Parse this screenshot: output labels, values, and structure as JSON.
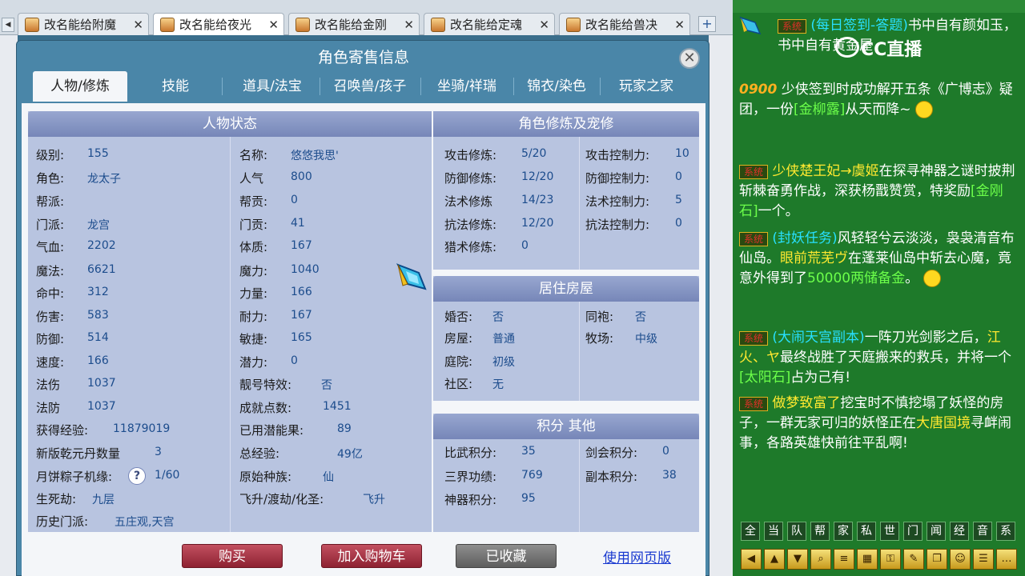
{
  "browser_tabs": [
    {
      "label": "改名能给附魔",
      "active": false
    },
    {
      "label": "改名能给夜光",
      "active": true
    },
    {
      "label": "改名能给金刚",
      "active": false
    },
    {
      "label": "改名能给定魂",
      "active": false
    },
    {
      "label": "改名能给兽决",
      "active": false
    }
  ],
  "dialog": {
    "title": "角色寄售信息",
    "tabs": [
      "人物/修炼",
      "技能",
      "道具/法宝",
      "召唤兽/孩子",
      "坐骑/祥瑞",
      "锦衣/染色",
      "玩家之家"
    ],
    "active_tab": "人物/修炼"
  },
  "status_panel": {
    "title": "人物状态",
    "left": [
      {
        "label": "级别:",
        "value": "155"
      },
      {
        "label": "角色:",
        "value": "龙太子"
      },
      {
        "label": "帮派:",
        "value": ""
      },
      {
        "label": "门派:",
        "value": "龙宫"
      },
      {
        "label": "气血:",
        "value": "2202"
      },
      {
        "label": "魔法:",
        "value": "6621"
      },
      {
        "label": "命中:",
        "value": "312"
      },
      {
        "label": "伤害:",
        "value": "583"
      },
      {
        "label": "防御:",
        "value": "514"
      },
      {
        "label": "速度:",
        "value": "166"
      },
      {
        "label": "法伤",
        "value": "1037"
      },
      {
        "label": "法防",
        "value": "1037"
      },
      {
        "label": "获得经验:",
        "value": "11879019"
      },
      {
        "label": "新版乾元丹数量",
        "value": "3"
      },
      {
        "label": "月饼粽子机缘:",
        "value": "1/60"
      },
      {
        "label": "生死劫:",
        "value": "九层"
      },
      {
        "label": "历史门派:",
        "value": "五庄观,天宫"
      }
    ],
    "right": [
      {
        "label": "名称:",
        "value": "悠悠我思'"
      },
      {
        "label": "人气",
        "value": "800"
      },
      {
        "label": "帮贡:",
        "value": "0"
      },
      {
        "label": "门贡:",
        "value": "41"
      },
      {
        "label": "体质:",
        "value": "167"
      },
      {
        "label": "魔力:",
        "value": "1040"
      },
      {
        "label": "力量:",
        "value": "166"
      },
      {
        "label": "耐力:",
        "value": "167"
      },
      {
        "label": "敏捷:",
        "value": "165"
      },
      {
        "label": "潜力:",
        "value": "0"
      },
      {
        "label": "靓号特效:",
        "value": "否"
      },
      {
        "label": "成就点数:",
        "value": "1451"
      },
      {
        "label": "已用潜能果:",
        "value": "89"
      },
      {
        "label": "总经验:",
        "value": "49亿"
      },
      {
        "label": "原始种族:",
        "value": "仙"
      },
      {
        "label": "飞升/渡劫/化圣:",
        "value": "飞升"
      }
    ],
    "help_glyph": "?"
  },
  "cultivation_panel": {
    "title": "角色修炼及宠修",
    "rows": [
      {
        "label": "攻击修炼:",
        "value": "5/20",
        "label2": "攻击控制力:",
        "value2": "10"
      },
      {
        "label": "防御修炼:",
        "value": "12/20",
        "label2": "防御控制力:",
        "value2": "0"
      },
      {
        "label": "法术修炼",
        "value": "14/23",
        "label2": "法术控制力:",
        "value2": "5"
      },
      {
        "label": "抗法修炼:",
        "value": "12/20",
        "label2": "抗法控制力:",
        "value2": "0"
      },
      {
        "label": "猎术修炼:",
        "value": "0",
        "label2": "",
        "value2": ""
      }
    ]
  },
  "house_panel": {
    "title": "居住房屋",
    "rows": [
      {
        "label": "婚否:",
        "value": "否",
        "label2": "同袍:",
        "value2": "否"
      },
      {
        "label": "房屋:",
        "value": "普通",
        "label2": "牧场:",
        "value2": "中级"
      },
      {
        "label": "庭院:",
        "value": "初级",
        "label2": "",
        "value2": ""
      },
      {
        "label": "社区:",
        "value": "无",
        "label2": "",
        "value2": ""
      }
    ]
  },
  "points_panel": {
    "title": "积分 其他",
    "rows": [
      {
        "label": "比武积分:",
        "value": "35",
        "label2": "剑会积分:",
        "value2": "0"
      },
      {
        "label": "三界功绩:",
        "value": "769",
        "label2": "副本积分:",
        "value2": "38"
      },
      {
        "label": "神器积分:",
        "value": "95",
        "label2": "",
        "value2": ""
      }
    ]
  },
  "buttons": {
    "buy": "购买",
    "add_cart": "加入购物车",
    "favorited": "已收藏",
    "web_link": "使用网页版"
  },
  "chat": {
    "logo_text": "CC直播",
    "sys_badge": "系统",
    "m1_a": "(每日签到-答题)",
    "m1_b": "书中自有颜如玉，书中自有黄金屋",
    "m2_num": "0900",
    "m2_text": "少侠签到时成功解开五条《广博志》疑团，一份",
    "m2_item": "[金柳露]",
    "m2_end": "从天而降~",
    "m3_name": "少侠楚王妃→虞姬",
    "m3_text": "在探寻神器之谜时披荆斩棘奋勇作战，深获杨戬赞赏，特奖励",
    "m3_item": "[金刚石]",
    "m3_end": "一个。",
    "m4_a": "(封妖任务)",
    "m4_b": "风轻轻兮云淡淡，袅袅清音布仙岛。",
    "m4_name": "眼前荒芜ヴ",
    "m4_c": "在蓬莱仙岛中斩去心魔，竟意外得到了",
    "m4_d": "50000两储备金",
    "m4_end": "。",
    "m5_a": "(大闹天宫副本)",
    "m5_b": "一阵刀光剑影之后，",
    "m5_name": "江火、ヤ",
    "m5_c": "最终战胜了天庭搬来的救兵，并将一个",
    "m5_item": "[太阳石]",
    "m5_end": "占为己有!",
    "m6_name": "做梦致富了",
    "m6_text": "挖宝时不慎挖塌了妖怪的房子，一群无家可归的妖怪正在",
    "m6_place": "大唐国境",
    "m6_end": "寻衅闹事，各路英雄快前往平乱啊!",
    "channels": [
      "全",
      "当",
      "队",
      "帮",
      "家",
      "私",
      "世",
      "门",
      "闻",
      "经",
      "音",
      "系"
    ],
    "tools": [
      "◀",
      "▲",
      "▼",
      "⌕",
      "≡",
      "▦",
      "⚿",
      "✎",
      "❐",
      "☺",
      "☰",
      "…"
    ]
  }
}
